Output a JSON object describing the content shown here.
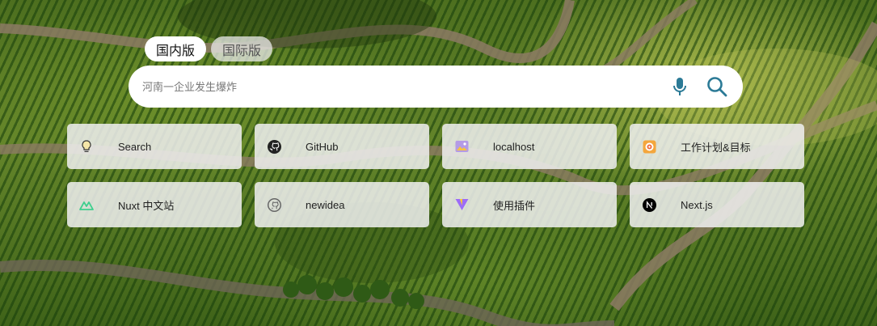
{
  "tabs": [
    {
      "label": "国内版",
      "active": true
    },
    {
      "label": "国际版",
      "active": false
    }
  ],
  "search": {
    "placeholder": "河南一企业发生爆炸",
    "value": "",
    "icons": [
      "microphone-icon",
      "search-icon"
    ],
    "accent": "#2b7a96"
  },
  "shortcuts": [
    {
      "label": "Search",
      "icon": "lightbulb-icon"
    },
    {
      "label": "GitHub",
      "icon": "github-icon"
    },
    {
      "label": "localhost",
      "icon": "image-icon"
    },
    {
      "label": "工作计划&目标",
      "icon": "target-icon"
    },
    {
      "label": "Nuxt 中文站",
      "icon": "nuxt-icon"
    },
    {
      "label": "newidea",
      "icon": "github-icon"
    },
    {
      "label": "使用插件",
      "icon": "vite-icon"
    },
    {
      "label": "Next.js",
      "icon": "nextjs-icon"
    }
  ]
}
